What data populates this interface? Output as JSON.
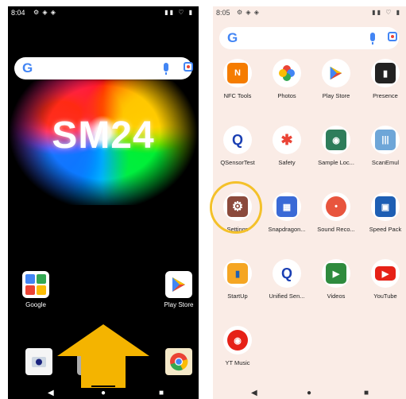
{
  "left_screen": {
    "status": {
      "time": "8:04"
    },
    "search": {
      "logo": "G"
    },
    "wallpaper_text": "SM24",
    "apps": [
      {
        "label": "Google",
        "icon": "google-folder-icon"
      },
      {
        "label": "Play Store",
        "icon": "play-store-icon"
      }
    ],
    "dock": [
      {
        "icon": "camera-icon"
      },
      {
        "icon": "phone-icon"
      },
      {
        "icon": "chrome-icon"
      }
    ],
    "overlay": {
      "icon": "swipe-up-arrow-icon",
      "color": "#f4b400"
    }
  },
  "right_screen": {
    "status": {
      "time": "8:05"
    },
    "search": {
      "logo": "G"
    },
    "apps": [
      {
        "label": "NFC Tools",
        "icon": "nfc-tools-icon"
      },
      {
        "label": "Photos",
        "icon": "photos-icon"
      },
      {
        "label": "Play Store",
        "icon": "play-store-icon"
      },
      {
        "label": "Presence",
        "icon": "presence-icon"
      },
      {
        "label": "QSensorTest",
        "icon": "qsensortest-icon"
      },
      {
        "label": "Safety",
        "icon": "safety-icon"
      },
      {
        "label": "Sample Loc...",
        "icon": "sample-loc-icon"
      },
      {
        "label": "ScanEmul",
        "icon": "scanemul-icon"
      },
      {
        "label": "Settings",
        "icon": "settings-gear-icon"
      },
      {
        "label": "Snapdragon...",
        "icon": "snapdragon-icon"
      },
      {
        "label": "Sound Reco...",
        "icon": "sound-recorder-icon"
      },
      {
        "label": "Speed Pack",
        "icon": "speed-pack-icon"
      },
      {
        "label": "StartUp",
        "icon": "startup-icon"
      },
      {
        "label": "Unified Sen...",
        "icon": "unified-sensor-icon"
      },
      {
        "label": "Videos",
        "icon": "videos-icon"
      },
      {
        "label": "YouTube",
        "icon": "youtube-icon"
      },
      {
        "label": "YT Music",
        "icon": "yt-music-icon"
      }
    ],
    "highlight": {
      "target": "Settings",
      "color": "#f4c12a"
    }
  }
}
